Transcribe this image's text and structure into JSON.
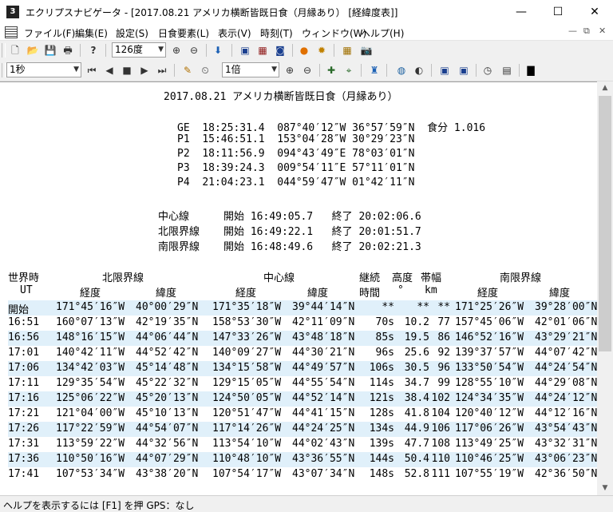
{
  "window": {
    "title": "エクリプスナビゲータ - [2017.08.21 アメリカ横断皆既日食（月縁あり）  [経緯度表]]",
    "minimize": "—",
    "maximize": "☐",
    "close": "✕"
  },
  "menu": {
    "items": [
      {
        "label": "ファイル(F)"
      },
      {
        "label": "編集(E)"
      },
      {
        "label": "設定(S)"
      },
      {
        "label": "日食要素(L)"
      },
      {
        "label": "表示(V)"
      },
      {
        "label": "時刻(T)"
      },
      {
        "label": "ウィンドウ(W)"
      },
      {
        "label": "ヘルプ(H)"
      }
    ],
    "mdi_minimize": "—",
    "mdi_restore": "⧉",
    "mdi_close": "✕"
  },
  "toolbar1": {
    "zoom_combo": "126度"
  },
  "toolbar2": {
    "interval_combo": "1秒",
    "speed_combo": "1倍"
  },
  "doc": {
    "title": "2017.08.21 アメリカ横断皆既日食（月縁あり）",
    "contacts": [
      {
        "label": "GE",
        "time": "18:25:31.4",
        "lon": "087°40′12″W",
        "lat": "36°57′59″N",
        "extra": "食分 1.016"
      },
      {
        "label": "P1",
        "time": "15:46:51.1",
        "lon": "153°04′28″W",
        "lat": "30°29′23″N",
        "extra": ""
      },
      {
        "label": "P2",
        "time": "18:11:56.9",
        "lon": "094°43′49″E",
        "lat": "78°03′01″N",
        "extra": ""
      },
      {
        "label": "P3",
        "time": "18:39:24.3",
        "lon": "009°54′11″E",
        "lat": "57°11′01″N",
        "extra": ""
      },
      {
        "label": "P4",
        "time": "21:04:23.1",
        "lon": "044°59′47″W",
        "lat": "01°42′11″N",
        "extra": ""
      }
    ],
    "lines": [
      {
        "name": "中心線",
        "start_label": "開始",
        "start": "16:49:05.7",
        "end_label": "終了",
        "end": "20:02:06.6"
      },
      {
        "name": "北限界線",
        "start_label": "開始",
        "start": "16:49:22.1",
        "end_label": "終了",
        "end": "20:01:51.7"
      },
      {
        "name": "南限界線",
        "start_label": "開始",
        "start": "16:48:49.6",
        "end_label": "終了",
        "end": "20:02:21.3"
      }
    ],
    "table": {
      "header1": {
        "time": "世界時",
        "north": "北限界線",
        "center": "中心線",
        "duration": "継続",
        "altitude": "高度",
        "width": "帯幅",
        "south": "南限界線"
      },
      "header2": {
        "time": "UT",
        "north_lon": "経度",
        "north_lat": "緯度",
        "center_lon": "経度",
        "center_lat": "緯度",
        "duration": "時間",
        "altitude": "°",
        "width": "km",
        "south_lon": "経度",
        "south_lat": "緯度"
      },
      "rows": [
        [
          "開始",
          "171°45′16″W",
          "40°00′29″N",
          "171°35′18″W",
          "39°44′14″N",
          "**",
          "**",
          "**",
          "171°25′26″W",
          "39°28′00″N"
        ],
        [
          "16:51",
          "160°07′13″W",
          "42°19′35″N",
          "158°53′30″W",
          "42°11′09″N",
          "70s",
          "10.2",
          "77",
          "157°45′06″W",
          "42°01′06″N"
        ],
        [
          "16:56",
          "148°16′15″W",
          "44°06′44″N",
          "147°33′26″W",
          "43°48′18″N",
          "85s",
          "19.5",
          "86",
          "146°52′16″W",
          "43°29′21″N"
        ],
        [
          "17:01",
          "140°42′11″W",
          "44°52′42″N",
          "140°09′27″W",
          "44°30′21″N",
          "96s",
          "25.6",
          "92",
          "139°37′57″W",
          "44°07′42″N"
        ],
        [
          "17:06",
          "134°42′03″W",
          "45°14′48″N",
          "134°15′58″W",
          "44°49′57″N",
          "106s",
          "30.5",
          "96",
          "133°50′54″W",
          "44°24′54″N"
        ],
        [
          "17:11",
          "129°35′54″W",
          "45°22′32″N",
          "129°15′05″W",
          "44°55′54″N",
          "114s",
          "34.7",
          "99",
          "128°55′10″W",
          "44°29′08″N"
        ],
        [
          "17:16",
          "125°06′22″W",
          "45°20′13″N",
          "124°50′05″W",
          "44°52′14″N",
          "121s",
          "38.4",
          "102",
          "124°34′35″W",
          "44°24′12″N"
        ],
        [
          "17:21",
          "121°04′00″W",
          "45°10′13″N",
          "120°51′47″W",
          "44°41′15″N",
          "128s",
          "41.8",
          "104",
          "120°40′12″W",
          "44°12′16″N"
        ],
        [
          "17:26",
          "117°22′59″W",
          "44°54′07″N",
          "117°14′26″W",
          "44°24′25″N",
          "134s",
          "44.9",
          "106",
          "117°06′26″W",
          "43°54′43″N"
        ],
        [
          "17:31",
          "113°59′22″W",
          "44°32′56″N",
          "113°54′10″W",
          "44°02′43″N",
          "139s",
          "47.7",
          "108",
          "113°49′25″W",
          "43°32′31″N"
        ],
        [
          "17:36",
          "110°50′16″W",
          "44°07′29″N",
          "110°48′10″W",
          "43°36′55″N",
          "144s",
          "50.4",
          "110",
          "110°46′25″W",
          "43°06′23″N"
        ],
        [
          "17:41",
          "107°53′34″W",
          "43°38′20″N",
          "107°54′17″W",
          "43°07′34″N",
          "148s",
          "52.8",
          "111",
          "107°55′19″W",
          "42°36′50″N"
        ]
      ]
    }
  },
  "status": {
    "text": "ヘルプを表示するには [F1] を押  GPS：なし"
  }
}
